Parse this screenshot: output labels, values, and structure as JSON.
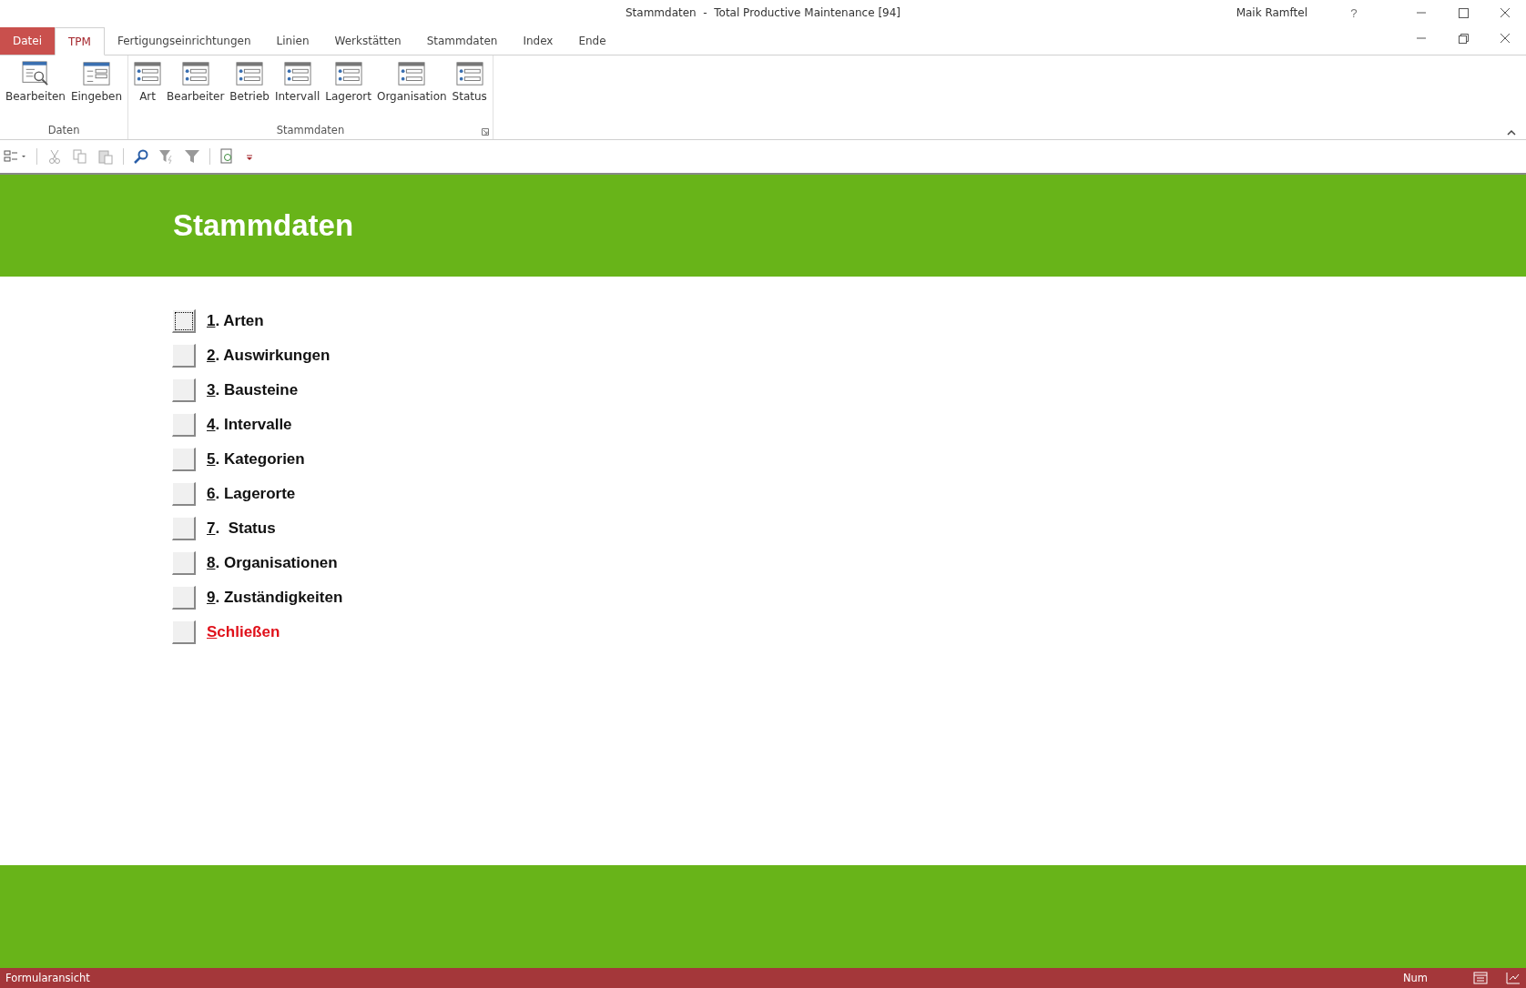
{
  "window": {
    "title": "Stammdaten  -  Total Productive Maintenance [94]",
    "user": "Maik Ramftel",
    "help": "?"
  },
  "tabs": [
    {
      "label": "Datei",
      "kind": "file",
      "selected": false
    },
    {
      "label": "TPM",
      "kind": "tab",
      "selected": true
    },
    {
      "label": "Fertigungseinrichtungen",
      "kind": "tab",
      "selected": false
    },
    {
      "label": "Linien",
      "kind": "tab",
      "selected": false
    },
    {
      "label": "Werkstätten",
      "kind": "tab",
      "selected": false
    },
    {
      "label": "Stammdaten",
      "kind": "tab",
      "selected": false
    },
    {
      "label": "Index",
      "kind": "tab",
      "selected": false
    },
    {
      "label": "Ende",
      "kind": "tab",
      "selected": false
    }
  ],
  "ribbon": {
    "groups": [
      {
        "label": "Daten",
        "launcher": false,
        "buttons": [
          {
            "label": "Bearbeiten",
            "kind": "search"
          },
          {
            "label": "Eingeben",
            "kind": "form"
          }
        ]
      },
      {
        "label": "Stammdaten",
        "launcher": true,
        "buttons": [
          {
            "label": "Art",
            "kind": "list"
          },
          {
            "label": "Bearbeiter",
            "kind": "list"
          },
          {
            "label": "Betrieb",
            "kind": "list"
          },
          {
            "label": "Intervall",
            "kind": "list"
          },
          {
            "label": "Lagerort",
            "kind": "list"
          },
          {
            "label": "Organisation",
            "kind": "list"
          },
          {
            "label": "Status",
            "kind": "list"
          }
        ]
      }
    ]
  },
  "form": {
    "title": "Stammdaten",
    "items": [
      {
        "hotkey": "1",
        "label": ". Arten",
        "kind": "menu",
        "focused": true
      },
      {
        "hotkey": "2",
        "label": ". Auswirkungen",
        "kind": "menu",
        "focused": false
      },
      {
        "hotkey": "3",
        "label": ". Bausteine",
        "kind": "menu",
        "focused": false
      },
      {
        "hotkey": "4",
        "label": ". Intervalle",
        "kind": "menu",
        "focused": false
      },
      {
        "hotkey": "5",
        "label": ". Kategorien",
        "kind": "menu",
        "focused": false
      },
      {
        "hotkey": "6",
        "label": ". Lagerorte",
        "kind": "menu",
        "focused": false
      },
      {
        "hotkey": "7",
        "label": ".  Status",
        "kind": "menu",
        "focused": false
      },
      {
        "hotkey": "8",
        "label": ". Organisationen",
        "kind": "menu",
        "focused": false
      },
      {
        "hotkey": "9",
        "label": ". Zuständigkeiten",
        "kind": "menu",
        "focused": false
      },
      {
        "hotkey": "S",
        "label": "chließen",
        "kind": "close",
        "focused": false
      }
    ]
  },
  "status_bar": {
    "text": "Formularansicht",
    "num": "Num"
  }
}
